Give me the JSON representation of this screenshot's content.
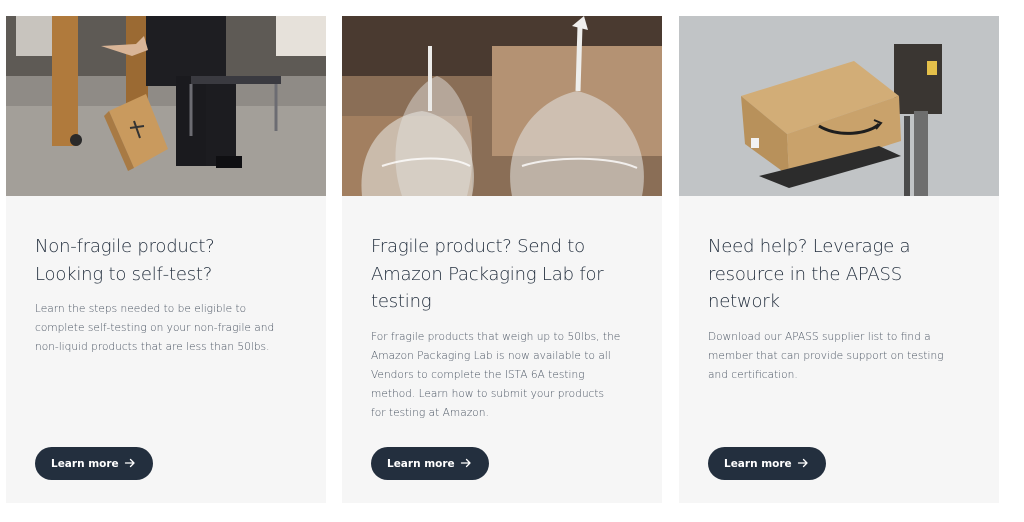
{
  "cards": [
    {
      "image": "warehouse-worker-dropping-box-photo",
      "title": "Non-fragile product? Looking to self-test?",
      "text": "Learn the steps needed to be eligible to complete self-testing on your non-fragile and non-liquid products that are less than 50lbs.",
      "button_label": "Learn more",
      "button_icon": "arrow-right-icon"
    },
    {
      "image": "wine-glasses-photo",
      "title": "Fragile product? Send to Amazon Packaging Lab for testing",
      "text": "For fragile products that weigh up to 50lbs, the Amazon Packaging Lab is now available to all Vendors to complete the ISTA 6A testing method. Learn how to submit your products for testing at Amazon.",
      "button_label": "Learn more",
      "button_icon": "arrow-right-icon"
    },
    {
      "image": "amazon-box-in-test-rig-photo",
      "title": "Need help? Leverage a resource in the APASS network",
      "text": "Download our APASS supplier list to find a member that can provide support on testing and certification.",
      "button_label": "Learn more",
      "button_icon": "arrow-right-icon"
    }
  ],
  "colors": {
    "card_background": "#f6f6f6",
    "button_background": "#232f3e",
    "title_color": "#232f3e",
    "text_color": "#4b5563"
  }
}
